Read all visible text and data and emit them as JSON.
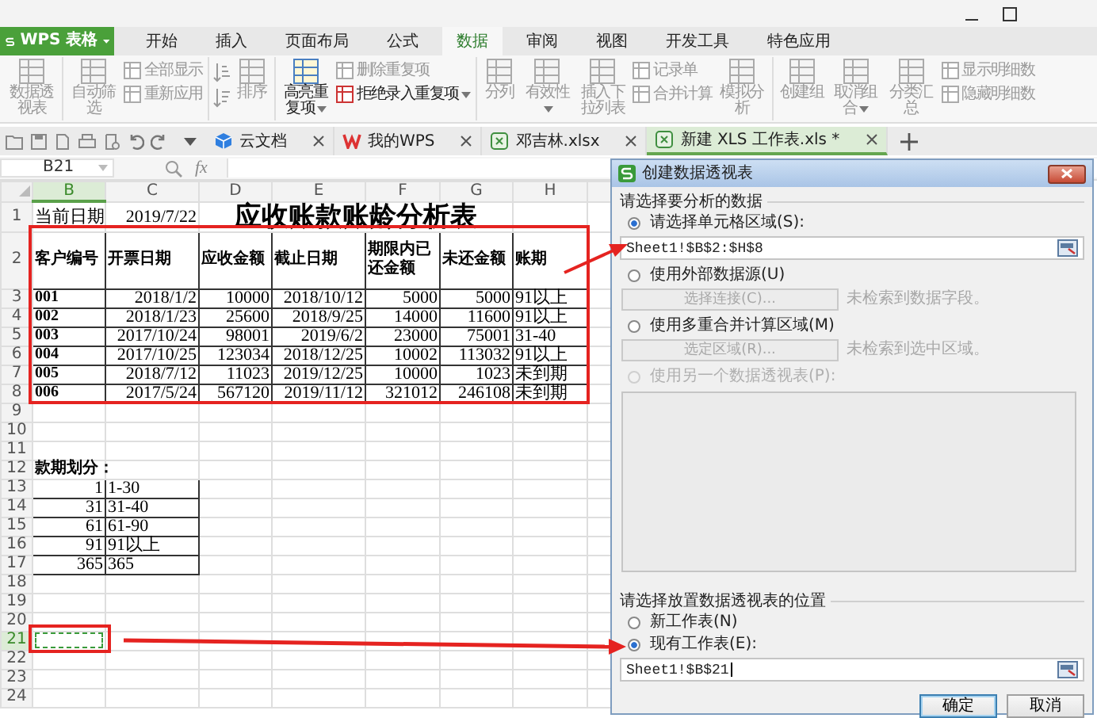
{
  "app_menu": {
    "label": "WPS 表格"
  },
  "ribbon_tabs": [
    {
      "label": "开始",
      "selected": false
    },
    {
      "label": "插入",
      "selected": false
    },
    {
      "label": "页面布局",
      "selected": false
    },
    {
      "label": "公式",
      "selected": false
    },
    {
      "label": "数据",
      "selected": true
    },
    {
      "label": "审阅",
      "selected": false
    },
    {
      "label": "视图",
      "selected": false
    },
    {
      "label": "开发工具",
      "selected": false
    },
    {
      "label": "特色应用",
      "selected": false
    }
  ],
  "ribbon_groups": [
    {
      "items": [
        {
          "kind": "large",
          "label": "数据透视表",
          "disabled": true,
          "dropdown": false
        }
      ]
    },
    {
      "items": [
        {
          "kind": "large",
          "label": "自动筛选",
          "disabled": true,
          "dropdown": false
        },
        {
          "kind": "stack",
          "items": [
            {
              "label": "全部显示",
              "disabled": true,
              "dropdown": false
            },
            {
              "label": "重新应用",
              "disabled": true,
              "dropdown": false
            }
          ]
        }
      ]
    },
    {
      "items": [
        {
          "kind": "sort",
          "label": "排序",
          "disabled": true,
          "dropdown": false
        }
      ]
    },
    {
      "items": [
        {
          "kind": "large",
          "label": "高亮重复项",
          "disabled": false,
          "dropdown": true
        },
        {
          "kind": "stack",
          "items": [
            {
              "label": "删除重复项",
              "disabled": true,
              "dropdown": false
            },
            {
              "label": "拒绝录入重复项",
              "disabled": false,
              "dropdown": true
            }
          ]
        }
      ]
    },
    {
      "items": [
        {
          "kind": "large",
          "label": "分列",
          "disabled": true,
          "dropdown": false
        },
        {
          "kind": "large",
          "label": "有效性",
          "disabled": true,
          "dropdown": true
        },
        {
          "kind": "large",
          "label": "插入下拉列表",
          "disabled": true,
          "dropdown": false
        },
        {
          "kind": "stack",
          "items": [
            {
              "label": "记录单",
              "disabled": true,
              "dropdown": false
            },
            {
              "label": "合并计算",
              "disabled": true,
              "dropdown": false
            }
          ]
        },
        {
          "kind": "large",
          "label": "模拟分析",
          "disabled": true,
          "dropdown": false
        }
      ]
    },
    {
      "items": [
        {
          "kind": "large",
          "label": "创建组",
          "disabled": true,
          "dropdown": false
        },
        {
          "kind": "large",
          "label": "取消组合",
          "disabled": true,
          "dropdown": true
        },
        {
          "kind": "large",
          "label": "分类汇总",
          "disabled": true,
          "dropdown": false
        },
        {
          "kind": "stack",
          "items": [
            {
              "label": "显示明细数",
              "disabled": true,
              "dropdown": false
            },
            {
              "label": "隐藏明细数",
              "disabled": true,
              "dropdown": false
            }
          ]
        }
      ]
    }
  ],
  "doc_tabs": [
    {
      "kind": "cloud",
      "label": "云文档",
      "selected": false
    },
    {
      "kind": "wps",
      "label": "我的WPS",
      "selected": false
    },
    {
      "kind": "sheet",
      "label": "邓吉林.xlsx",
      "selected": false
    },
    {
      "kind": "sheet",
      "label": "新建 XLS 工作表.xls *",
      "selected": true
    }
  ],
  "formula_bar": {
    "cell_ref": "B21",
    "fx_label": "fx"
  },
  "sheet": {
    "columns": [
      {
        "label": "B",
        "selected": true
      },
      {
        "label": "C",
        "selected": false
      },
      {
        "label": "D",
        "selected": false
      },
      {
        "label": "E",
        "selected": false
      },
      {
        "label": "F",
        "selected": false
      },
      {
        "label": "G",
        "selected": false
      },
      {
        "label": "H",
        "selected": false
      }
    ],
    "rows": [
      {
        "number": "1",
        "selected": false,
        "bordered": false,
        "cells": [
          {
            "kind": "text",
            "text": "当前日期"
          },
          {
            "kind": "number",
            "text": "2019/7/22"
          },
          {
            "kind": "title",
            "text": "应收账款账龄分析表"
          }
        ]
      },
      {
        "number": "2",
        "selected": false,
        "bordered": true,
        "cells": [
          {
            "kind": "heading",
            "text": "客户编号"
          },
          {
            "kind": "heading",
            "text": "开票日期"
          },
          {
            "kind": "heading",
            "text": "应收金额"
          },
          {
            "kind": "heading",
            "text": "截止日期"
          },
          {
            "kind": "heading",
            "text": "期限内已还金额"
          },
          {
            "kind": "heading",
            "text": "未还金额"
          },
          {
            "kind": "heading",
            "text": "账期"
          }
        ]
      },
      {
        "number": "3",
        "selected": false,
        "bordered": true,
        "cells": [
          {
            "kind": "label",
            "text": "001"
          },
          {
            "kind": "number",
            "text": "2018/1/2"
          },
          {
            "kind": "number",
            "text": "10000"
          },
          {
            "kind": "number",
            "text": "2018/10/12"
          },
          {
            "kind": "number",
            "text": "5000"
          },
          {
            "kind": "number",
            "text": "5000"
          },
          {
            "kind": "text",
            "text": "91以上"
          }
        ]
      },
      {
        "number": "4",
        "selected": false,
        "bordered": true,
        "cells": [
          {
            "kind": "label",
            "text": "002"
          },
          {
            "kind": "number",
            "text": "2018/1/23"
          },
          {
            "kind": "number",
            "text": "25600"
          },
          {
            "kind": "number",
            "text": "2018/9/25"
          },
          {
            "kind": "number",
            "text": "14000"
          },
          {
            "kind": "number",
            "text": "11600"
          },
          {
            "kind": "text",
            "text": "91以上"
          }
        ]
      },
      {
        "number": "5",
        "selected": false,
        "bordered": true,
        "cells": [
          {
            "kind": "label",
            "text": "003"
          },
          {
            "kind": "number",
            "text": "2017/10/24"
          },
          {
            "kind": "number",
            "text": "98001"
          },
          {
            "kind": "number",
            "text": "2019/6/2"
          },
          {
            "kind": "number",
            "text": "23000"
          },
          {
            "kind": "number",
            "text": "75001"
          },
          {
            "kind": "text",
            "text": "31-40"
          }
        ]
      },
      {
        "number": "6",
        "selected": false,
        "bordered": true,
        "cells": [
          {
            "kind": "label",
            "text": "004"
          },
          {
            "kind": "number",
            "text": "2017/10/25"
          },
          {
            "kind": "number",
            "text": "123034"
          },
          {
            "kind": "number",
            "text": "2018/12/25"
          },
          {
            "kind": "number",
            "text": "10002"
          },
          {
            "kind": "number",
            "text": "113032"
          },
          {
            "kind": "text",
            "text": "91以上"
          }
        ]
      },
      {
        "number": "7",
        "selected": false,
        "bordered": true,
        "cells": [
          {
            "kind": "label",
            "text": "005"
          },
          {
            "kind": "number",
            "text": "2018/7/12"
          },
          {
            "kind": "number",
            "text": "11023"
          },
          {
            "kind": "number",
            "text": "2019/12/25"
          },
          {
            "kind": "number",
            "text": "10000"
          },
          {
            "kind": "number",
            "text": "1023"
          },
          {
            "kind": "text",
            "text": "未到期"
          }
        ]
      },
      {
        "number": "8",
        "selected": false,
        "bordered": true,
        "cells": [
          {
            "kind": "label",
            "text": "006"
          },
          {
            "kind": "number",
            "text": "2017/5/24"
          },
          {
            "kind": "number",
            "text": "567120"
          },
          {
            "kind": "number",
            "text": "2019/11/12"
          },
          {
            "kind": "number",
            "text": "321012"
          },
          {
            "kind": "number",
            "text": "246108"
          },
          {
            "kind": "text",
            "text": "未到期"
          }
        ]
      },
      {
        "number": "9",
        "selected": false
      },
      {
        "number": "10",
        "selected": false
      },
      {
        "number": "11",
        "selected": false
      },
      {
        "number": "12",
        "selected": false,
        "bordered": false,
        "cells": [
          {
            "kind": "caption",
            "text": "款期划分："
          }
        ]
      },
      {
        "number": "13",
        "selected": false,
        "bordered": true,
        "cells": [
          {
            "kind": "number",
            "text": "1"
          },
          {
            "kind": "text",
            "text": "1-30"
          }
        ]
      },
      {
        "number": "14",
        "selected": false,
        "bordered": true,
        "cells": [
          {
            "kind": "number",
            "text": "31"
          },
          {
            "kind": "text",
            "text": "31-40"
          }
        ]
      },
      {
        "number": "15",
        "selected": false,
        "bordered": true,
        "cells": [
          {
            "kind": "number",
            "text": "61"
          },
          {
            "kind": "text",
            "text": "61-90"
          }
        ]
      },
      {
        "number": "16",
        "selected": false,
        "bordered": true,
        "cells": [
          {
            "kind": "number",
            "text": "91"
          },
          {
            "kind": "text",
            "text": "91以上"
          }
        ]
      },
      {
        "number": "17",
        "selected": false,
        "bordered": true,
        "cells": [
          {
            "kind": "number",
            "text": "365"
          },
          {
            "kind": "text",
            "text": "365"
          }
        ]
      },
      {
        "number": "18",
        "selected": false
      },
      {
        "number": "19",
        "selected": false
      },
      {
        "number": "20",
        "selected": false
      },
      {
        "number": "21",
        "selected": true,
        "cells": [
          {
            "kind": "marquee"
          }
        ]
      },
      {
        "number": "22",
        "selected": false
      },
      {
        "number": "23",
        "selected": false
      },
      {
        "number": "24",
        "selected": false
      }
    ]
  },
  "dialog": {
    "title": "创建数据透视表",
    "source_section": {
      "heading": "请选择要分析的数据",
      "options": [
        {
          "kind": "field",
          "label": "请选择单元格区域(S):",
          "selected": true,
          "disabled": false,
          "value": "Sheet1!$B$2:$H$8"
        },
        {
          "kind": "button",
          "label": "使用外部数据源(U)",
          "selected": false,
          "disabled": false,
          "button": "选择连接(C)...",
          "note": "未检索到数据字段。"
        },
        {
          "kind": "button",
          "label": "使用多重合并计算区域(M)",
          "selected": false,
          "disabled": false,
          "button": "选定区域(R)...",
          "note": "未检索到选中区域。"
        },
        {
          "kind": "list",
          "label": "使用另一个数据透视表(P):",
          "selected": false,
          "disabled": true
        }
      ]
    },
    "target_section": {
      "heading": "请选择放置数据透视表的位置",
      "options": [
        {
          "label": "新工作表(N)",
          "selected": false
        },
        {
          "label": "现有工作表(E):",
          "selected": true
        }
      ],
      "value": "Sheet1!$B$21"
    },
    "buttons": [
      {
        "label": "确定",
        "default": true
      },
      {
        "label": "取消",
        "default": false
      }
    ]
  }
}
